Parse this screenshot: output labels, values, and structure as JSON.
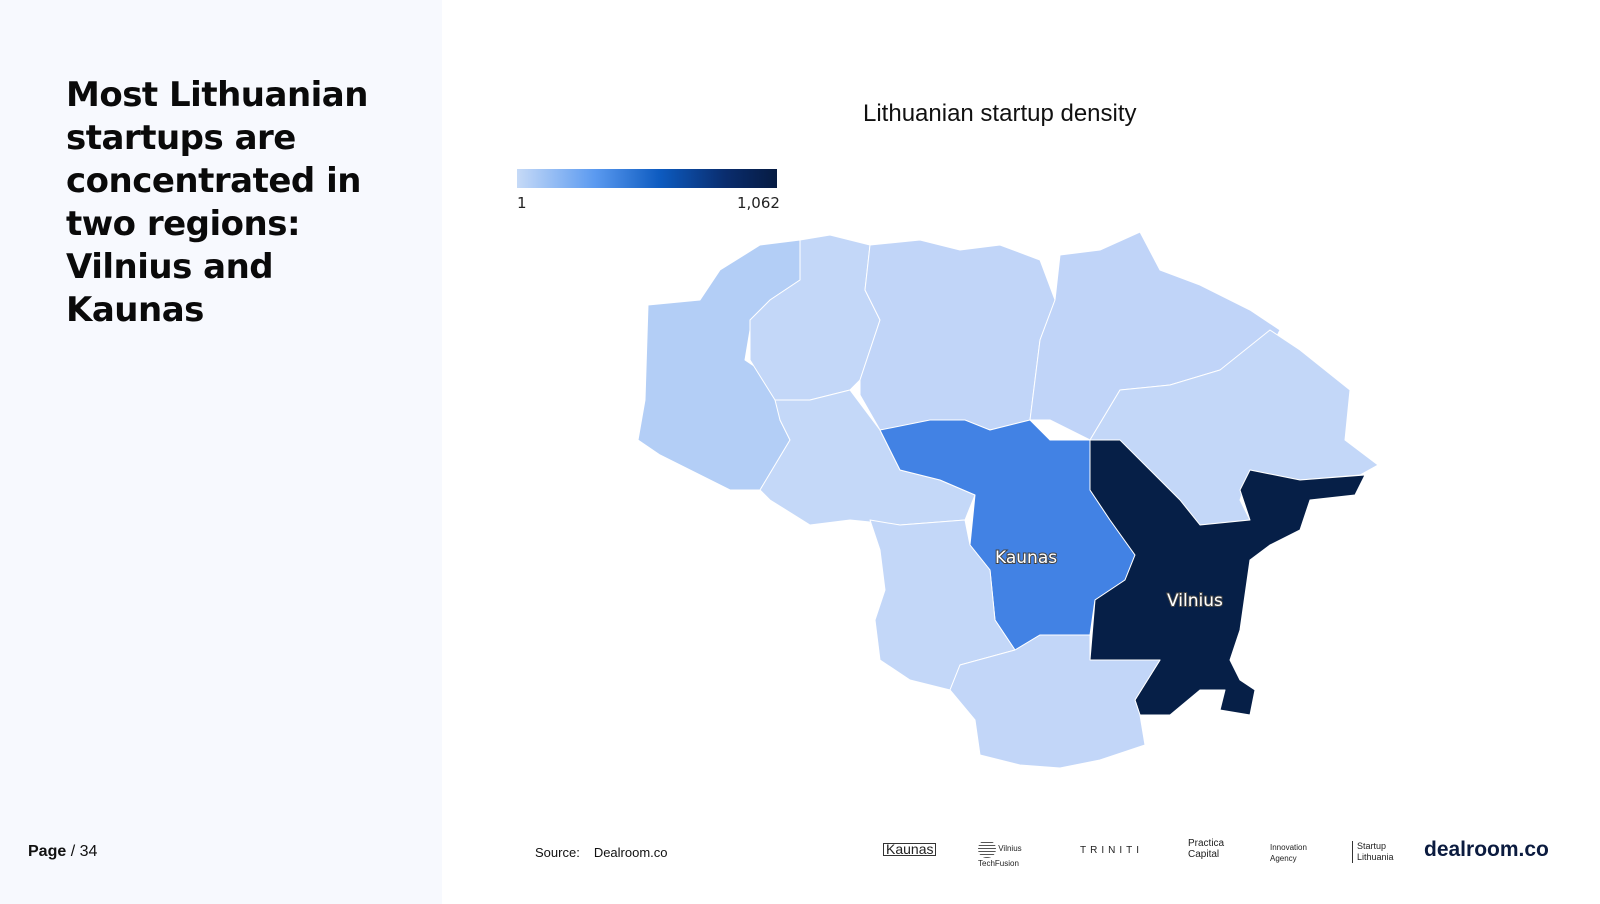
{
  "headline": "Most Lithuanian startups are concentrated in two regions: Vilnius and Kaunas",
  "footer": {
    "page_label": "Page",
    "page_number": "/ 34",
    "source_label": "Source:",
    "source_value": "Dealroom.co"
  },
  "map": {
    "title": "Lithuanian startup density",
    "legend": {
      "min": "1",
      "max": "1,062",
      "colors": [
        "#c6daf7",
        "#5b9af0",
        "#0d5bc0",
        "#061b42"
      ]
    },
    "region_labels": [
      "Kaunas",
      "Vilnius"
    ],
    "colors": {
      "low": "#c3d7f8",
      "klaipeda": "#b3cef6",
      "kaunas": "#4282e4",
      "vilnius": "#061f47"
    }
  },
  "logos": [
    "Kaunas",
    "Vilnius TechFusion",
    "TRINITI",
    "Practica Capital",
    "Innovation Agency",
    "Startup Lithuania",
    "dealroom.co"
  ]
}
